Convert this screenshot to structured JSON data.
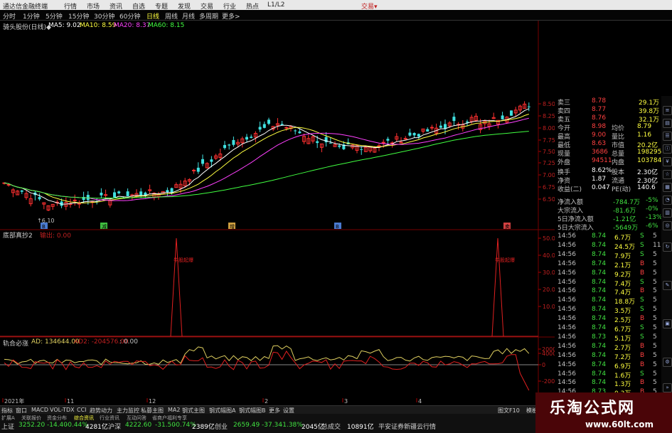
{
  "titlebar": {
    "app_name": "通达信金融终端",
    "menu": [
      "行情",
      "市场",
      "资讯",
      "自选",
      "专题",
      "发现",
      "交易",
      "行业",
      "热点",
      "L1/L2"
    ],
    "right": "交易▾"
  },
  "toolbar": {
    "periods": [
      "分时",
      "1分钟",
      "5分钟",
      "15分钟",
      "30分钟",
      "60分钟",
      "日线",
      "周线",
      "月线",
      "多周期",
      "更多>"
    ],
    "active_period": "日线"
  },
  "main_pane": {
    "title": "骑头股份(日线)◆",
    "ma": [
      {
        "label": "MA5: 9.02",
        "color": "#ffffff"
      },
      {
        "label": "MA10: 8.59",
        "color": "#ffff40"
      },
      {
        "label": "MA20: 8.37",
        "color": "#ff40ff"
      },
      {
        "label": "MA60: 8.15",
        "color": "#40ff40"
      }
    ],
    "low_label": "6.10",
    "price_axis": [
      "8.50",
      "8.25",
      "8.00",
      "7.75",
      "7.50",
      "7.25",
      "7.00",
      "6.75",
      "6.50"
    ],
    "markers": [
      {
        "text": "B",
        "color": "#4a7ad0"
      },
      {
        "text": "减",
        "color": "#40c040"
      },
      {
        "text": "增",
        "color": "#d0a040"
      },
      {
        "text": "B",
        "color": "#4a7ad0"
      },
      {
        "text": "卖",
        "color": "#d04040"
      }
    ]
  },
  "pane2": {
    "title": "底部真抄2",
    "value_label": "输出: 0.00",
    "annotation": "牛股起爆",
    "axis": [
      "50.00",
      "40.00",
      "30.00",
      "20.00",
      "10.00"
    ]
  },
  "pane3": {
    "title": "轨合必涨",
    "ad_label": "AD: 134644.00",
    "ad2_label": "AD2: -204576.00",
    "extra_label": ": 0.00",
    "axis": [
      "40000",
      "20000",
      "0",
      "-20000"
    ]
  },
  "date_axis": [
    "2021年",
    "11",
    "12",
    "2",
    "3",
    "4"
  ],
  "quote": {
    "asks": [
      {
        "label": "卖三",
        "price": "8.78",
        "vol": "29.1万"
      },
      {
        "label": "卖四",
        "price": "8.77",
        "vol": "39.8万"
      },
      {
        "label": "卖五",
        "price": "8.76",
        "vol": "32.1万"
      }
    ],
    "stats": [
      {
        "l1": "今开",
        "v1": "8.98",
        "l2": "均价",
        "v2": "8.79"
      },
      {
        "l1": "最高",
        "v1": "9.00",
        "l2": "量比",
        "v2": "1.16"
      },
      {
        "l1": "最低",
        "v1": "8.63",
        "l2": "市值",
        "v2": "20.2亿"
      },
      {
        "l1": "现量",
        "v1": "3686",
        "l2": "总量",
        "v2": "198295"
      },
      {
        "l1": "外盘",
        "v1": "94511",
        "l2": "内盘",
        "v2": "103784"
      }
    ],
    "stats2": [
      {
        "l1": "换手",
        "v1": "8.62%",
        "l2": "股本",
        "v2": "2.30亿"
      },
      {
        "l1": "净资",
        "v1": "1.87",
        "l2": "流通",
        "v2": "2.30亿"
      },
      {
        "l1": "收益(二)",
        "v1": "0.047",
        "l2": "PE(动)",
        "v2": "140.6"
      }
    ],
    "flows": [
      {
        "label": "净流入额",
        "val": "-784.7万",
        "pct": "-5%"
      },
      {
        "label": "大宗流入",
        "val": "-81.6万",
        "pct": "-0%"
      },
      {
        "label": "5日净流入额",
        "val": "-1.21亿",
        "pct": "-13%"
      },
      {
        "label": "5日大宗流入",
        "val": "-5649万",
        "pct": "-6%"
      }
    ]
  },
  "ticks": [
    {
      "time": "14:56",
      "price": "8.74",
      "vol": "6.7万",
      "dir": "S",
      "n": "5"
    },
    {
      "time": "14:56",
      "price": "8.74",
      "vol": "24.5万",
      "dir": "S",
      "n": "11"
    },
    {
      "time": "14:56",
      "price": "8.74",
      "vol": "7.9万",
      "dir": "S",
      "n": "5"
    },
    {
      "time": "14:56",
      "price": "8.74",
      "vol": "2.1万",
      "dir": "B",
      "n": "5"
    },
    {
      "time": "14:56",
      "price": "8.74",
      "vol": "9.2万",
      "dir": "B",
      "n": "5"
    },
    {
      "time": "14:56",
      "price": "8.74",
      "vol": "7.4万",
      "dir": "S",
      "n": "5"
    },
    {
      "time": "14:56",
      "price": "8.74",
      "vol": "7.4万",
      "dir": "B",
      "n": "5"
    },
    {
      "time": "14:56",
      "price": "8.74",
      "vol": "18.8万",
      "dir": "S",
      "n": "5"
    },
    {
      "time": "14:56",
      "price": "8.74",
      "vol": "3.5万",
      "dir": "S",
      "n": "5"
    },
    {
      "time": "14:56",
      "price": "8.74",
      "vol": "2.5万",
      "dir": "B",
      "n": "5"
    },
    {
      "time": "14:56",
      "price": "8.74",
      "vol": "6.7万",
      "dir": "S",
      "n": "5"
    },
    {
      "time": "14:56",
      "price": "8.73",
      "vol": "5.1万",
      "dir": "S",
      "n": "5"
    },
    {
      "time": "14:56",
      "price": "8.74",
      "vol": "2.7万",
      "dir": "B",
      "n": "5"
    },
    {
      "time": "14:56",
      "price": "8.74",
      "vol": "7.2万",
      "dir": "B",
      "n": "5"
    },
    {
      "time": "14:56",
      "price": "8.74",
      "vol": "6.9万",
      "dir": "B",
      "n": "5"
    },
    {
      "time": "14:56",
      "price": "8.74",
      "vol": "1.6万",
      "dir": "S",
      "n": "5"
    },
    {
      "time": "14:56",
      "price": "8.74",
      "vol": "1.3万",
      "dir": "B",
      "n": "5"
    },
    {
      "time": "14:56",
      "price": "8.73",
      "vol": "0.3万",
      "dir": "B",
      "n": "5"
    }
  ],
  "bottom_tabs": [
    "指标",
    "窗口",
    "MACD",
    "VOL-TDX",
    "CCI",
    "趋势动力",
    "主力监控",
    "私募主图",
    "MA2",
    "钢式主图",
    "钢式幅图A",
    "钢式幅图B",
    "更多",
    "设置"
  ],
  "bottom_tabs_right": [
    "图文F10",
    "模板"
  ],
  "bottom_tabs2": [
    "扩展A",
    "关联报价",
    "资金分布",
    "综合资讯",
    "行业资讯",
    "互动问答",
    "省商户福利专享"
  ],
  "status": [
    {
      "text": "上证",
      "color": "#d0d0d0"
    },
    {
      "text": "3252.20",
      "color": "#40e040"
    },
    {
      "text": "-14.40",
      "color": "#40e040"
    },
    {
      "text": "-0.44%",
      "color": "#40e040"
    },
    {
      "text": "4281亿",
      "color": "#ffffff"
    },
    {
      "text": "沪深",
      "color": "#d0d0d0"
    },
    {
      "text": "4222.60",
      "color": "#40e040"
    },
    {
      "text": "-31.50",
      "color": "#40e040"
    },
    {
      "text": "-0.74%",
      "color": "#40e040"
    },
    {
      "text": "2389亿",
      "color": "#ffffff"
    },
    {
      "text": "创业",
      "color": "#d0d0d0"
    },
    {
      "text": "2659.49",
      "color": "#40e040"
    },
    {
      "text": "-37.34",
      "color": "#40e040"
    },
    {
      "text": "-1.38%",
      "color": "#40e040"
    },
    {
      "text": "2045亿",
      "color": "#ffffff"
    },
    {
      "text": "总成交",
      "color": "#d0d0d0"
    },
    {
      "text": "10891亿",
      "color": "#ffffff"
    },
    {
      "text": "平安证券新疆云行情",
      "color": "#d0d0d0"
    }
  ],
  "watermark": {
    "title": "乐淘公式网",
    "url": "www.60lt.com"
  },
  "colors": {
    "up": "#ff3030",
    "down": "#40e0e0",
    "ma5": "#ffffff",
    "ma10": "#ffff40",
    "ma20": "#ff40ff",
    "ma60": "#40ff40",
    "ad": "#e0d060",
    "ad2": "#e02020"
  }
}
